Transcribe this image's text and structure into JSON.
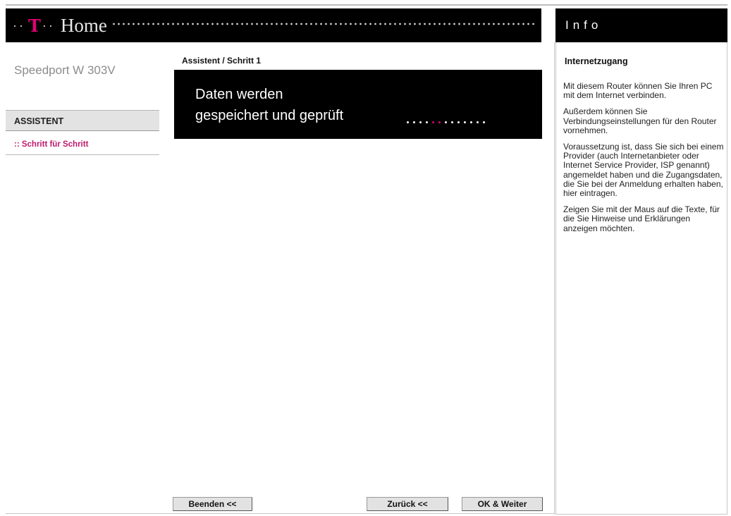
{
  "header": {
    "brand_prefix": "T",
    "brand_name": "Home",
    "info_title": "Info"
  },
  "sidebar": {
    "device_name": "Speedport W 303V",
    "section_label": "ASSISTENT",
    "items": [
      {
        "label": ":: Schritt für Schritt"
      }
    ]
  },
  "main": {
    "breadcrumb": "Assistent / Schritt 1",
    "message_line1": "Daten werden",
    "message_line2": "gespeichert und geprüft",
    "progress": {
      "total_dots": 13,
      "active_dots": [
        4,
        5
      ]
    }
  },
  "info": {
    "heading": "Internetzugang",
    "paragraphs": [
      "Mit diesem Router können Sie Ihren PC mit dem Internet verbinden.",
      "Außerdem können Sie Verbindungseinstellungen für den Router vornehmen.",
      "Voraussetzung ist, dass Sie sich bei einem Provider (auch Internetanbieter oder Internet Service Provider, ISP genannt) angemeldet haben und die Zugangsdaten, die Sie bei der Anmeldung erhalten haben, hier eintragen.",
      "Zeigen Sie mit der Maus auf die Texte, für die Sie Hinweise und Erklärungen anzeigen möchten."
    ]
  },
  "buttons": {
    "beenden": "Beenden <<",
    "zurueck": "Zurück <<",
    "ok": "OK & Weiter"
  },
  "colors": {
    "magenta": "#e20074",
    "bar": "#000000",
    "nav_bg": "#e3e3e3"
  }
}
